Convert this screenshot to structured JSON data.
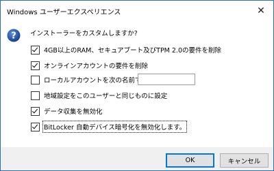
{
  "window": {
    "title": "Windows ユーザーエクスペリエンス",
    "close_glyph": "✕"
  },
  "prompt": "インストーラーをカスタムしますか?",
  "options": [
    {
      "label": "4GB以上のRAM、セキュアブート及びTPM 2.0の要件を削除",
      "checked": true
    },
    {
      "label": "オンラインアカウントの要件を削除",
      "checked": true
    },
    {
      "label": "ローカルアカウントを次の名前で作成:",
      "checked": false
    },
    {
      "label": "地域設定をこのユーザーと同じものに設定",
      "checked": false
    },
    {
      "label": "データ収集を無効化",
      "checked": true
    },
    {
      "label": "BitLocker 自動デバイス暗号化を無効化します。",
      "checked": true
    }
  ],
  "account_name_value": "",
  "buttons": {
    "ok": "OK",
    "cancel": "キャンセル"
  },
  "colors": {
    "accent": "#0078d7",
    "help_icon": "#1f4e9c",
    "footer": "#f0f0f0"
  }
}
